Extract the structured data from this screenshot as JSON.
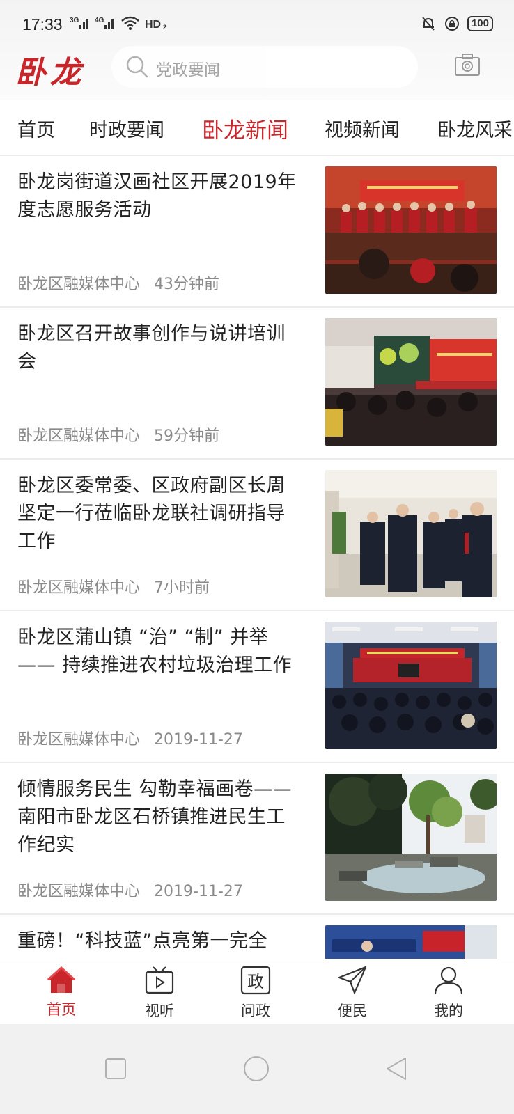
{
  "status_bar": {
    "time": "17:33",
    "signal1": "3G",
    "signal2": "4G",
    "hd": "HD2",
    "battery": "100"
  },
  "header": {
    "logo": "卧龙",
    "search_placeholder": "党政要闻",
    "camera_icon": "camera-icon"
  },
  "tabs": [
    {
      "label": "首页"
    },
    {
      "label": "时政要闻"
    },
    {
      "label": "卧龙新闻",
      "active": true
    },
    {
      "label": "视频新闻"
    },
    {
      "label": "卧龙风采"
    }
  ],
  "news": [
    {
      "title": "卧龙岗街道汉画社区开展2019年度志愿服务活动",
      "source": "卧龙区融媒体中心",
      "time": "43分钟前"
    },
    {
      "title": "卧龙区召开故事创作与说讲培训会",
      "source": "卧龙区融媒体中心",
      "time": "59分钟前"
    },
    {
      "title": "卧龙区委常委、区政府副区长周坚定一行莅临卧龙联社调研指导工作",
      "source": "卧龙区融媒体中心",
      "time": "7小时前"
    },
    {
      "title": "卧龙区蒲山镇 “治” “制” 并举—— 持续推进农村垃圾治理工作",
      "source": "卧龙区融媒体中心",
      "time": "2019-11-27"
    },
    {
      "title": "倾情服务民生 勾勒幸福画卷——南阳市卧龙区石桥镇推进民生工作纪实",
      "source": "卧龙区融媒体中心",
      "time": "2019-11-27"
    },
    {
      "title": "重磅！“科技蓝”点亮第一完全",
      "source": "",
      "time": ""
    }
  ],
  "bottom_nav": [
    {
      "label": "首页",
      "icon": "home-icon",
      "active": true
    },
    {
      "label": "视听",
      "icon": "tv-icon"
    },
    {
      "label": "问政",
      "icon": "zheng-icon",
      "glyph": "政"
    },
    {
      "label": "便民",
      "icon": "paper-plane-icon"
    },
    {
      "label": "我的",
      "icon": "user-icon"
    }
  ],
  "colors": {
    "accent": "#c8262b",
    "text": "#222222",
    "meta": "#8a8a8a"
  }
}
